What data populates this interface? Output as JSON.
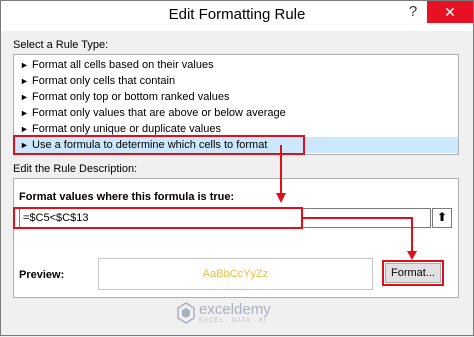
{
  "window": {
    "title": "Edit Formatting Rule",
    "help_glyph": "?",
    "close_glyph": "✕"
  },
  "rule_type": {
    "label_prefix": "Select a Rule Type:",
    "items": [
      {
        "label": "Format all cells based on their values",
        "selected": false
      },
      {
        "label": "Format only cells that contain",
        "selected": false
      },
      {
        "label": "Format only top or bottom ranked values",
        "selected": false
      },
      {
        "label": "Format only values that are above or below average",
        "selected": false
      },
      {
        "label": "Format only unique or duplicate values",
        "selected": false
      },
      {
        "label": "Use a formula to determine which cells to format",
        "selected": true
      }
    ],
    "item_glyph": "►"
  },
  "description": {
    "label": "Edit the Rule Description:",
    "formula_label": "Format values where this formula is true:",
    "formula_value": "=$C5<$C$13",
    "collapse_glyph": "⬆",
    "preview_label": "Preview:",
    "preview_sample": "AaBbCcYyZz",
    "format_button": "Format..."
  },
  "watermark": {
    "name": "exceldemy",
    "tagline": "EXCEL · DATA · BI"
  },
  "colors": {
    "highlight_red": "#e0101a",
    "selection": "#cce8ff",
    "preview_text": "#e8c23a"
  }
}
